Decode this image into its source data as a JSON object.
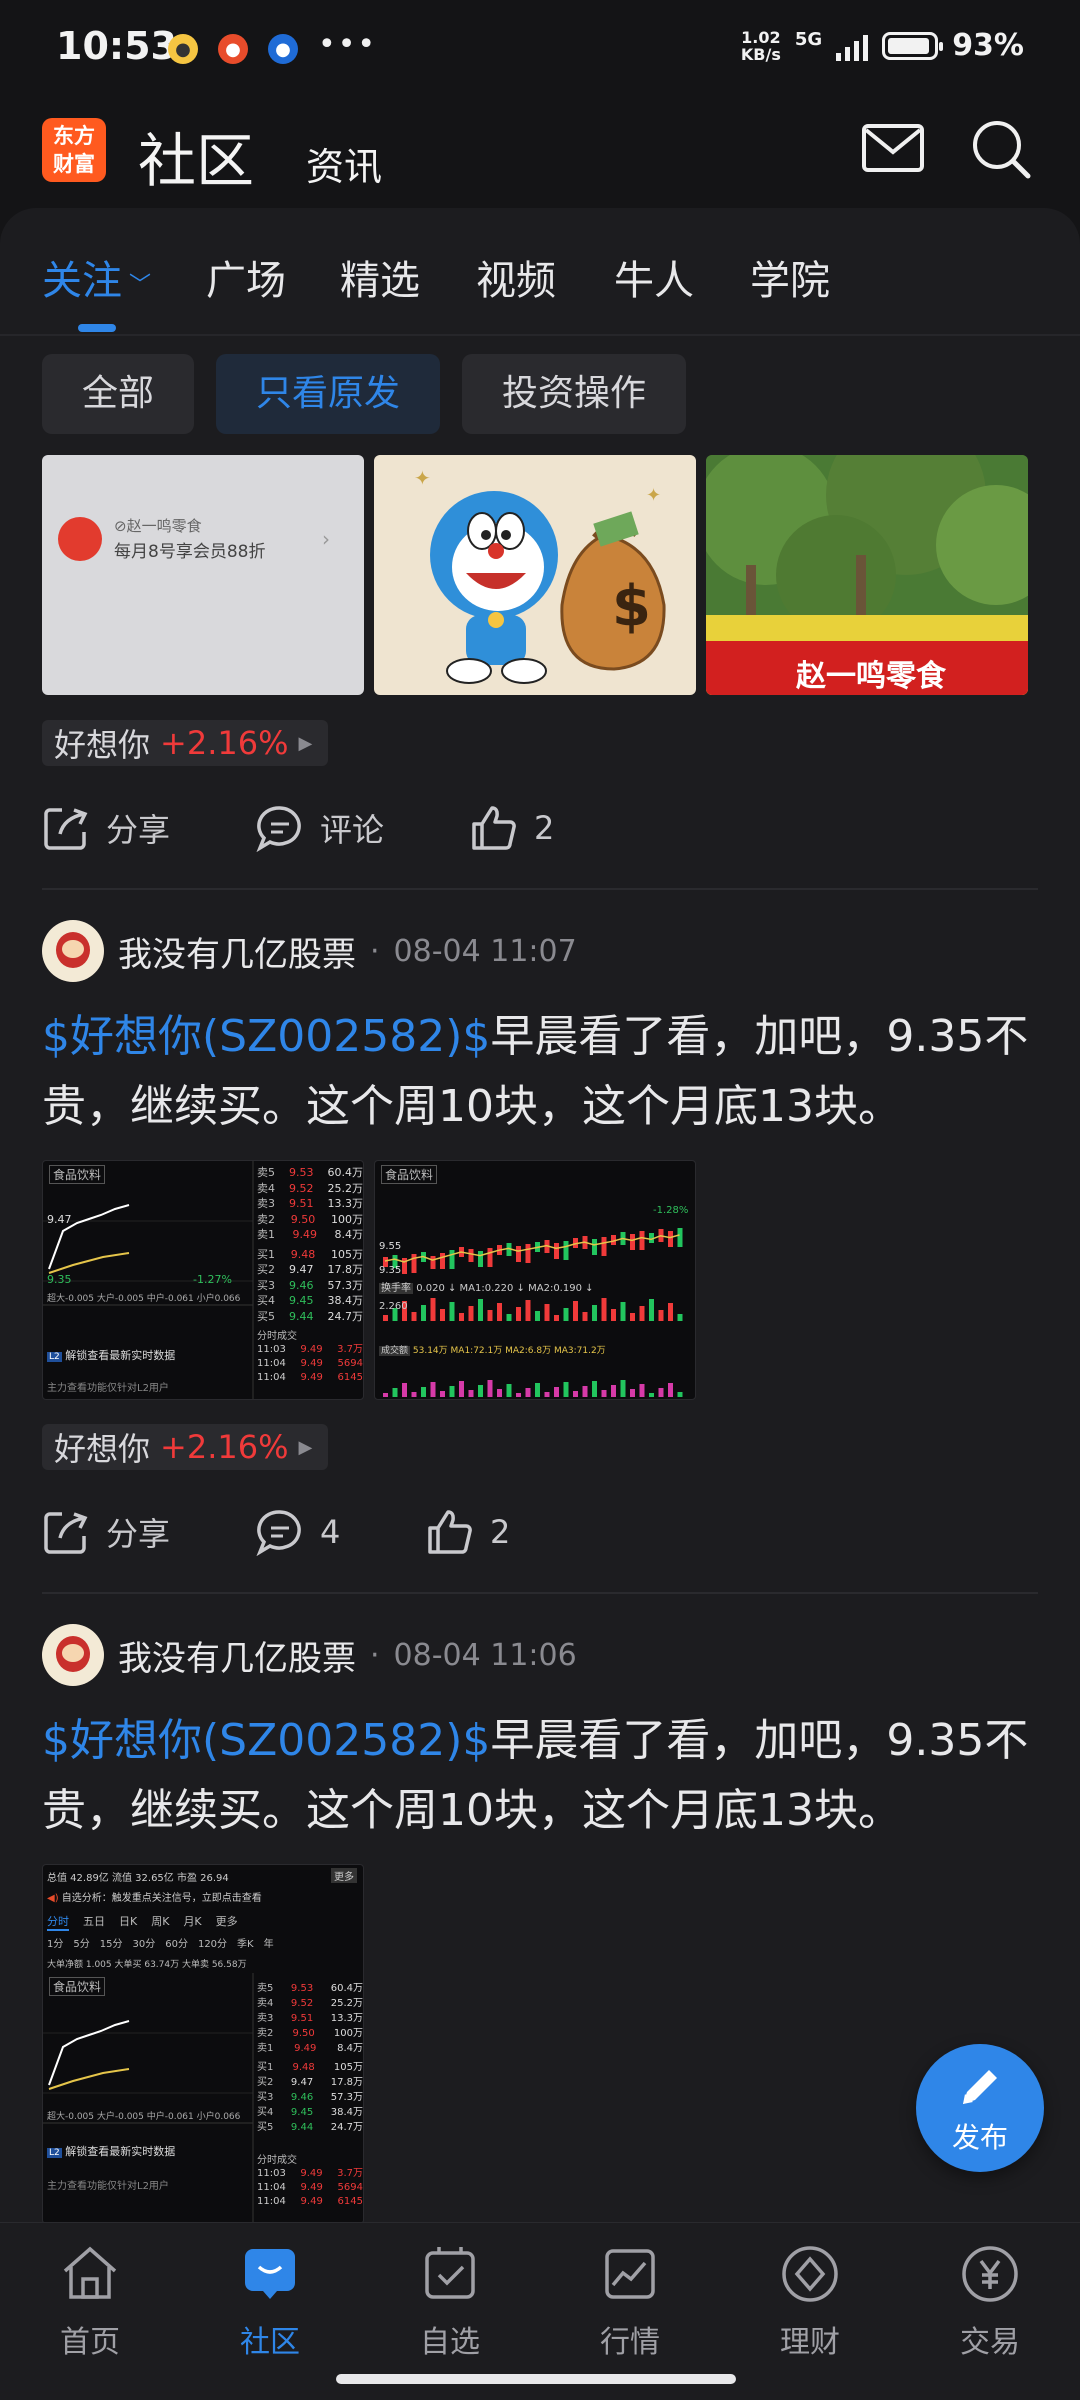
{
  "status_bar": {
    "time": "10:53",
    "speed_top": "1.02",
    "speed_bottom": "KB/s",
    "network": "5G",
    "battery_level": 0.93,
    "battery_text": "93%"
  },
  "header": {
    "logo_line1": "东方",
    "logo_line2": "财富",
    "title": "社区",
    "subtitle": "资讯",
    "mail_icon": "mail-icon",
    "search_icon": "search-icon"
  },
  "tabs": [
    {
      "label": "关注"
    },
    {
      "label": "广场"
    },
    {
      "label": "精选"
    },
    {
      "label": "视频"
    },
    {
      "label": "牛人"
    },
    {
      "label": "学院"
    }
  ],
  "filters": [
    {
      "label": "全部"
    },
    {
      "label": "只看原发"
    },
    {
      "label": "投资操作"
    }
  ],
  "post0": {
    "ad_brand": "赵一鸣零食",
    "ad_text": "每月8号享会员88折",
    "shop_sign": "赵一鸣零食",
    "stock_tag": {
      "name": "好想你",
      "change": "+2.16%"
    },
    "actions": {
      "share": "分享",
      "comment": "评论",
      "likes": "2"
    }
  },
  "post1": {
    "author": "我没有几亿股票",
    "time": "08-04 11:07",
    "ticker": "$好想你(SZ002582)$",
    "text": "早晨看了看，加吧，9.35不贵，继续买。这个周10块，这个月底13块。",
    "stock_tag": {
      "name": "好想你",
      "change": "+2.16%"
    },
    "actions": {
      "share": "分享",
      "comments": "4",
      "likes": "2"
    }
  },
  "post2": {
    "author": "我没有几亿股票",
    "time": "08-04 11:06",
    "ticker": "$好想你(SZ002582)$",
    "text": "早晨看了看，加吧，9.35不贵，继续买。这个周10块，这个月底13块。"
  },
  "shot_a": {
    "tag": "食品饮料",
    "price": "9.47",
    "low": "9.35",
    "pct": "-1.27%",
    "ask_rows": [
      {
        "lbl": "卖5",
        "p": "9.53",
        "v": "60.4万"
      },
      {
        "lbl": "卖4",
        "p": "9.52",
        "v": "25.2万"
      },
      {
        "lbl": "卖3",
        "p": "9.51",
        "v": "13.3万"
      },
      {
        "lbl": "卖2",
        "p": "9.50",
        "v": "100万"
      },
      {
        "lbl": "卖1",
        "p": "9.49",
        "v": "8.4万"
      }
    ],
    "bid_rows": [
      {
        "lbl": "买1",
        "p": "9.48",
        "v": "105万"
      },
      {
        "lbl": "买2",
        "p": "9.47",
        "v": "17.8万"
      },
      {
        "lbl": "买3",
        "p": "9.46",
        "v": "57.3万"
      },
      {
        "lbl": "买4",
        "p": "9.45",
        "v": "38.4万"
      },
      {
        "lbl": "买5",
        "p": "9.44",
        "v": "24.7万"
      }
    ],
    "ticks_title": "分时成交",
    "ticks": [
      {
        "t": "11:03",
        "p": "9.49",
        "v": "3.7万"
      },
      {
        "t": "11:04",
        "p": "9.49",
        "v": "5694"
      },
      {
        "t": "11:04",
        "p": "9.49",
        "v": "6145"
      }
    ],
    "flow_line": "超大-0.005 大户-0.005 中户-0.061 小户0.066",
    "banner": "解锁查看最新实时数据",
    "footer": "主力查看功能仅针对L2用户"
  },
  "shot_b": {
    "tag": "食品饮料",
    "lbl1": "换手率",
    "ma_line1": "0.020 ↓ MA1:0.220 ↓ MA2:0.190 ↓",
    "lbl2": "成交额",
    "ma_line2": "53.14万 MA1:72.1万 MA2:6.8万 MA3:71.2万",
    "val1": "2.260",
    "pct": "-1.28%",
    "price": "9.55",
    "low": "9.35"
  },
  "shot_c": {
    "top": "总值 42.89亿 流值 32.65亿 市盈 26.94",
    "more": "更多",
    "alert": "自选分析：触发重点关注信号，立即点击查看",
    "tabs": [
      "分时",
      "五日",
      "日K",
      "周K",
      "月K",
      "更多"
    ],
    "periods": [
      "1分",
      "5分",
      "15分",
      "30分",
      "60分",
      "120分",
      "季K",
      "年"
    ],
    "flow": "大单净额 1.005 大单买 63.74万 大单卖 56.58万"
  },
  "bottom_nav": [
    {
      "label": "首页",
      "icon": "home-icon"
    },
    {
      "label": "社区",
      "icon": "community-icon"
    },
    {
      "label": "自选",
      "icon": "watchlist-icon"
    },
    {
      "label": "行情",
      "icon": "market-chart-icon"
    },
    {
      "label": "理财",
      "icon": "wealth-icon"
    },
    {
      "label": "交易",
      "icon": "trade-yen-icon"
    }
  ],
  "fab": {
    "label": "发布"
  },
  "colors": {
    "accent": "#2f86e8",
    "up": "#f03a3a",
    "down": "#22c55e",
    "bg": "#1c1c1f"
  }
}
